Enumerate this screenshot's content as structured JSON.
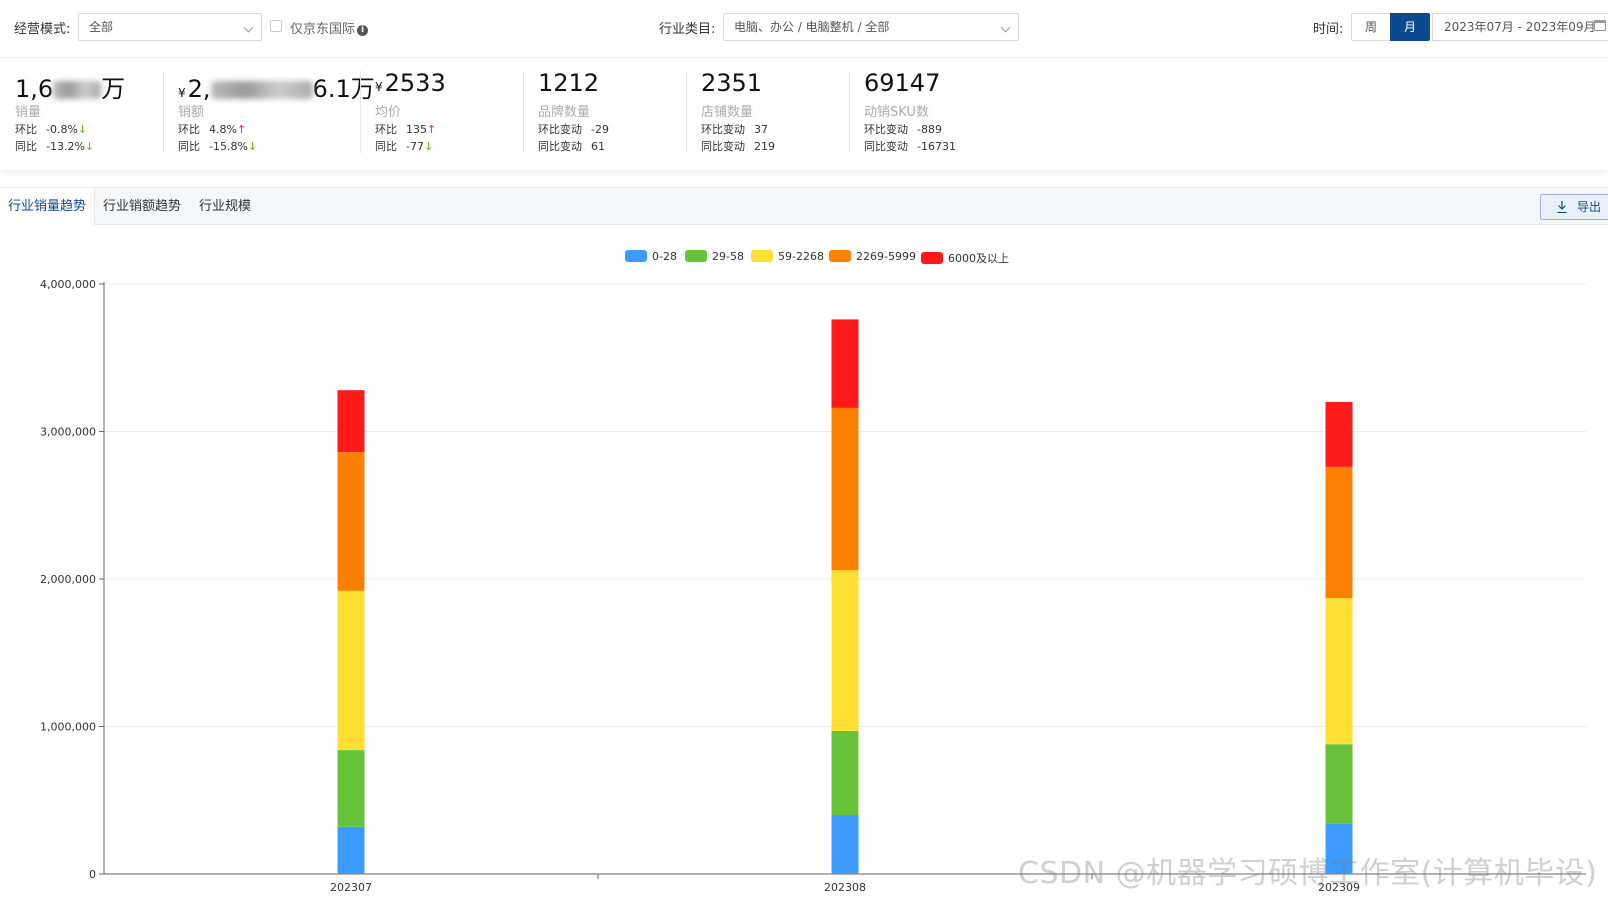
{
  "filters": {
    "mode_label": "经营模式:",
    "mode_value": "全部",
    "jd_intl_label": "仅京东国际",
    "info_icon": "i",
    "category_label": "行业类目:",
    "category_value": "电脑、办公 / 电脑整机 / 全部",
    "time_label": "时间:",
    "week_label": "周",
    "month_label": "月",
    "date_range": "2023年07月 - 2023年09月"
  },
  "stats": [
    {
      "value_prefix": "1,6",
      "value_suffix": "万",
      "currency": "",
      "name": "销量",
      "r1_key": "环比",
      "r1_val": "-0.8%",
      "r1_dir": "↓",
      "r2_key": "同比",
      "r2_val": "-13.2%",
      "r2_dir": "↓"
    },
    {
      "value_prefix": "2,",
      "value_suffix": "6.1万",
      "currency": "¥",
      "name": "销额",
      "r1_key": "环比",
      "r1_val": "4.8%",
      "r1_dir": "↑",
      "r2_key": "同比",
      "r2_val": "-15.8%",
      "r2_dir": "↓"
    },
    {
      "value_prefix": "2533",
      "value_suffix": "",
      "currency": "¥",
      "name": "均价",
      "r1_key": "环比",
      "r1_val": "135",
      "r1_dir": "↑",
      "r2_key": "同比",
      "r2_val": "-77",
      "r2_dir": "↓"
    },
    {
      "value_prefix": "1212",
      "value_suffix": "",
      "currency": "",
      "name": "品牌数量",
      "r1_key": "环比变动",
      "r1_val": "-29",
      "r1_dir": "",
      "r2_key": "同比变动",
      "r2_val": "61",
      "r2_dir": ""
    },
    {
      "value_prefix": "2351",
      "value_suffix": "",
      "currency": "",
      "name": "店铺数量",
      "r1_key": "环比变动",
      "r1_val": "37",
      "r1_dir": "",
      "r2_key": "同比变动",
      "r2_val": "219",
      "r2_dir": ""
    },
    {
      "value_prefix": "69147",
      "value_suffix": "",
      "currency": "",
      "name": "动销SKU数",
      "r1_key": "环比变动",
      "r1_val": "-889",
      "r1_dir": "",
      "r2_key": "同比变动",
      "r2_val": "-16731",
      "r2_dir": ""
    }
  ],
  "tabs": [
    {
      "label": "行业销量趋势",
      "active": true
    },
    {
      "label": "行业销额趋势",
      "active": false
    },
    {
      "label": "行业规模",
      "active": false
    }
  ],
  "export_label": "导出",
  "chart_data": {
    "type": "bar",
    "stacked": true,
    "categories": [
      "202307",
      "202308",
      "202309"
    ],
    "series": [
      {
        "name": "0-28",
        "color": "#3d9bff",
        "values": [
          320000,
          400000,
          340000
        ]
      },
      {
        "name": "29-58",
        "color": "#67c23a",
        "values": [
          520000,
          570000,
          540000
        ]
      },
      {
        "name": "59-2268",
        "color": "#ffdf33",
        "values": [
          1080000,
          1090000,
          990000
        ]
      },
      {
        "name": "2269-5999",
        "color": "#ff8000",
        "values": [
          940000,
          1100000,
          890000
        ]
      },
      {
        "name": "6000及以上",
        "color": "#ff1a1a",
        "values": [
          420000,
          600000,
          440000
        ]
      }
    ],
    "yticks": [
      "0",
      "1,000,000",
      "2,000,000",
      "3,000,000",
      "4,000,000"
    ],
    "ylim": [
      0,
      4000000
    ],
    "grid": true,
    "legend_position": "top-center"
  },
  "watermark": "CSDN @机器学习硕博工作室(计算机毕设)"
}
